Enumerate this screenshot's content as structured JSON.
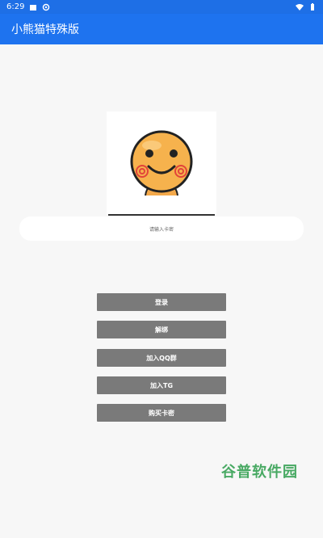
{
  "status_bar": {
    "time": "6:29",
    "icons": [
      "notification-icon",
      "settings-icon",
      "wifi-icon",
      "battery-icon"
    ]
  },
  "app_bar": {
    "title": "小熊猫特殊版"
  },
  "login": {
    "input_placeholder": "请输入卡密",
    "buttons": {
      "login": "登录",
      "unbind": "解绑",
      "join_qq": "加入QQ群",
      "join_tg": "加入TG",
      "buy_card": "购买卡密"
    }
  },
  "watermark": "谷普软件园",
  "colors": {
    "primary": "#1e73ef",
    "status_bar": "#1e6fe6",
    "button": "#7a7a7a",
    "background": "#f7f7f7",
    "watermark": "#2a9c4a"
  }
}
